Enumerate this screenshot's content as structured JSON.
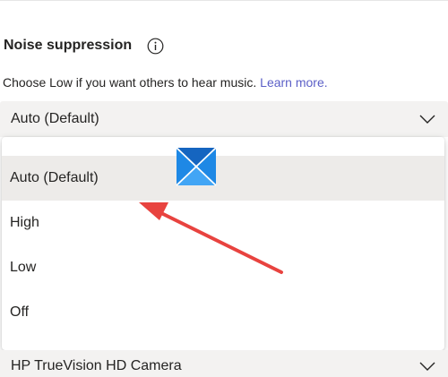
{
  "section": {
    "title": "Noise suppression",
    "description": "Choose Low if you want others to hear music.",
    "learn_more": "Learn more."
  },
  "noise_select": {
    "value": "Auto (Default)",
    "options": [
      "Auto (Default)",
      "High",
      "Low",
      "Off"
    ],
    "selected_index": 0
  },
  "camera_select": {
    "value": "HP TrueVision HD Camera"
  },
  "icons": {
    "info": "info-icon",
    "chevron": "chevron-down-icon",
    "logo": "windows-logo-icon",
    "annotation": "red-arrow-annotation"
  },
  "colors": {
    "link": "#5b5fc7",
    "select_bg": "#f3f2f1",
    "selected_option_bg": "#edebe9",
    "arrow": "#e8433f",
    "logo_blue": "#1e88e5"
  }
}
